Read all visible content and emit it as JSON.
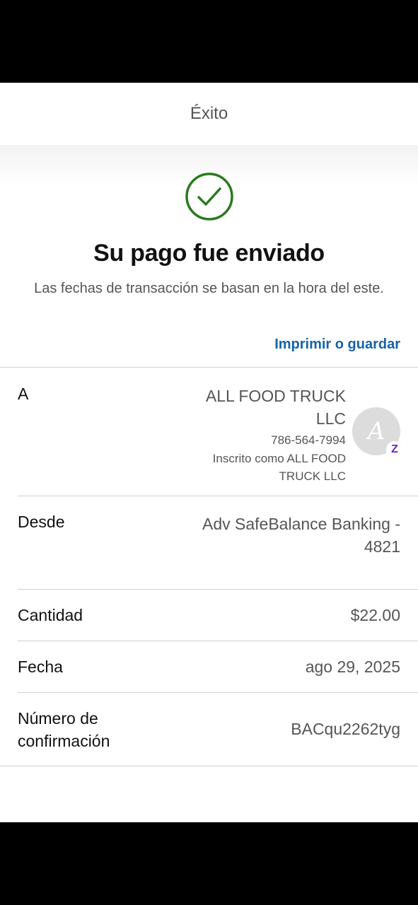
{
  "header": {
    "title": "Éxito"
  },
  "hero": {
    "title": "Su pago fue enviado",
    "subtitle": "Las fechas de transacción se basan en la hora del este."
  },
  "actions": {
    "print_label": "Imprimir o guardar"
  },
  "details": {
    "to": {
      "label": "A",
      "name": "ALL FOOD TRUCK LLC",
      "phone": "786-564-7994",
      "enrolled": "Inscrito como ALL FOOD TRUCK LLC",
      "avatar_letter": "A",
      "badge": "Z"
    },
    "from": {
      "label": "Desde",
      "value": "Adv SafeBalance Banking - 4821"
    },
    "amount": {
      "label": "Cantidad",
      "value": "$22.00"
    },
    "date": {
      "label": "Fecha",
      "value": "ago 29, 2025"
    },
    "confirmation": {
      "label": "Número de confirmación",
      "value": "BACqu2262tyg"
    }
  },
  "colors": {
    "success": "#2a7a1f",
    "link": "#1563a8",
    "zelle": "#6d1ed4"
  },
  "icons": {
    "success": "check-circle-icon"
  }
}
